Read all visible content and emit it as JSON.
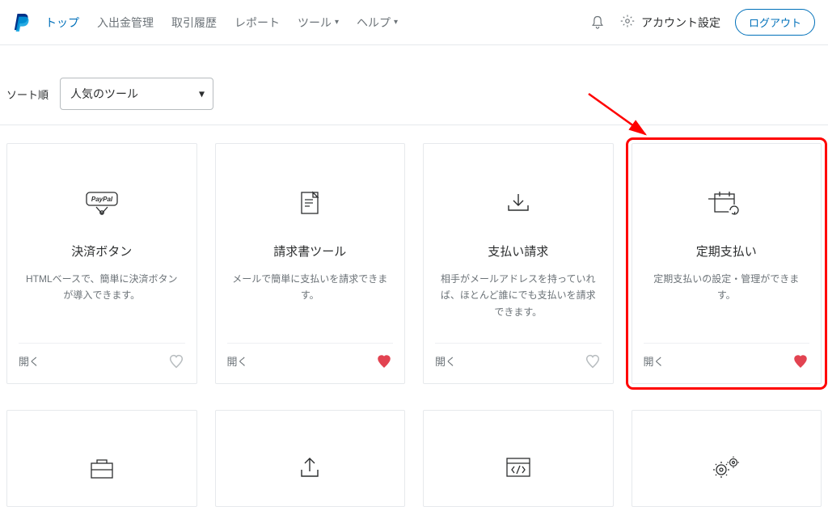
{
  "nav": {
    "top": "トップ",
    "money": "入出金管理",
    "history": "取引履歴",
    "report": "レポート",
    "tools": "ツール",
    "help": "ヘルプ",
    "account": "アカウント設定",
    "logout": "ログアウト"
  },
  "sort": {
    "label": "ソート順",
    "selected": "人気のツール"
  },
  "cards": [
    {
      "title": "決済ボタン",
      "desc": "HTMLベースで、簡単に決済ボタンが導入できます。",
      "open": "開く",
      "fav": false
    },
    {
      "title": "請求書ツール",
      "desc": "メールで簡単に支払いを請求できます。",
      "open": "開く",
      "fav": true
    },
    {
      "title": "支払い請求",
      "desc": "相手がメールアドレスを持っていれば、ほとんど誰にでも支払いを請求できます。",
      "open": "開く",
      "fav": false
    },
    {
      "title": "定期支払い",
      "desc": "定期支払いの設定・管理ができます。",
      "open": "開く",
      "fav": true
    }
  ]
}
